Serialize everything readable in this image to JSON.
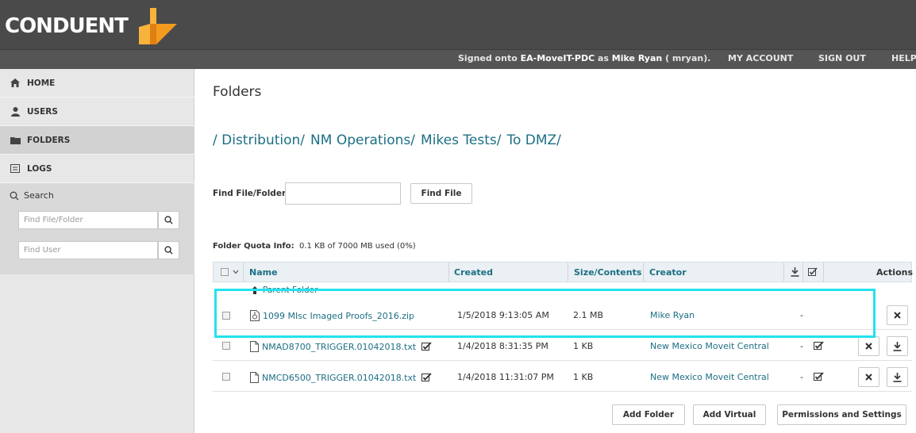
{
  "header": {
    "logo_text": "CONDUENT",
    "signed_prefix": "Signed onto ",
    "host": "EA-MoveIT-PDC",
    "signed_mid": " as ",
    "user_name": "Mike Ryan",
    "user_suffix": " ( mryan).",
    "nav": [
      "MY ACCOUNT",
      "SIGN OUT",
      "HELP"
    ]
  },
  "sidebar": {
    "items": [
      {
        "label": "HOME",
        "icon": "home-icon"
      },
      {
        "label": "USERS",
        "icon": "user-icon"
      },
      {
        "label": "FOLDERS",
        "icon": "folder-icon"
      },
      {
        "label": "LOGS",
        "icon": "list-icon"
      }
    ],
    "search_label": "Search",
    "find_file_placeholder": "Find File/Folder",
    "find_user_placeholder": "Find User"
  },
  "main": {
    "title": "Folders",
    "breadcrumb": [
      "/ Distribution/",
      "NM Operations/",
      "Mikes Tests/",
      "To DMZ/"
    ],
    "find_label": "Find File/Folder:",
    "find_button": "Find File",
    "quota_label": "Folder Quota Info:",
    "quota_value": "0.1 KB of 7000 MB used (0%)"
  },
  "table": {
    "headers": {
      "name": "Name",
      "created": "Created",
      "size": "Size/Contents",
      "creator": "Creator",
      "actions": "Actions"
    },
    "parent_folder": "Parent Folder",
    "rows": [
      {
        "name": "1099 MIsc Imaged Proofs_2016.zip",
        "created": "1/5/2018 9:13:05 AM",
        "size": "2.1 MB",
        "creator": "Mike Ryan",
        "dl": "-"
      },
      {
        "name": "NMAD8700_TRIGGER.01042018.txt",
        "created": "1/4/2018 8:31:35 PM",
        "size": "1 KB",
        "creator": "New Mexico Moveit Central",
        "dl": "-"
      },
      {
        "name": "NMCD6500_TRIGGER.01042018.txt",
        "created": "1/4/2018 11:31:07 PM",
        "size": "1 KB",
        "creator": "New Mexico Moveit Central",
        "dl": "-"
      }
    ]
  },
  "buttons": {
    "add_folder": "Add Folder",
    "add_virtual": "Add Virtual",
    "permissions": "Permissions and Settings"
  },
  "colors": {
    "accent": "#1d6f84",
    "highlight": "#22e3ee",
    "header": "#4a4a4a",
    "logo_orange": "#f5a623"
  }
}
